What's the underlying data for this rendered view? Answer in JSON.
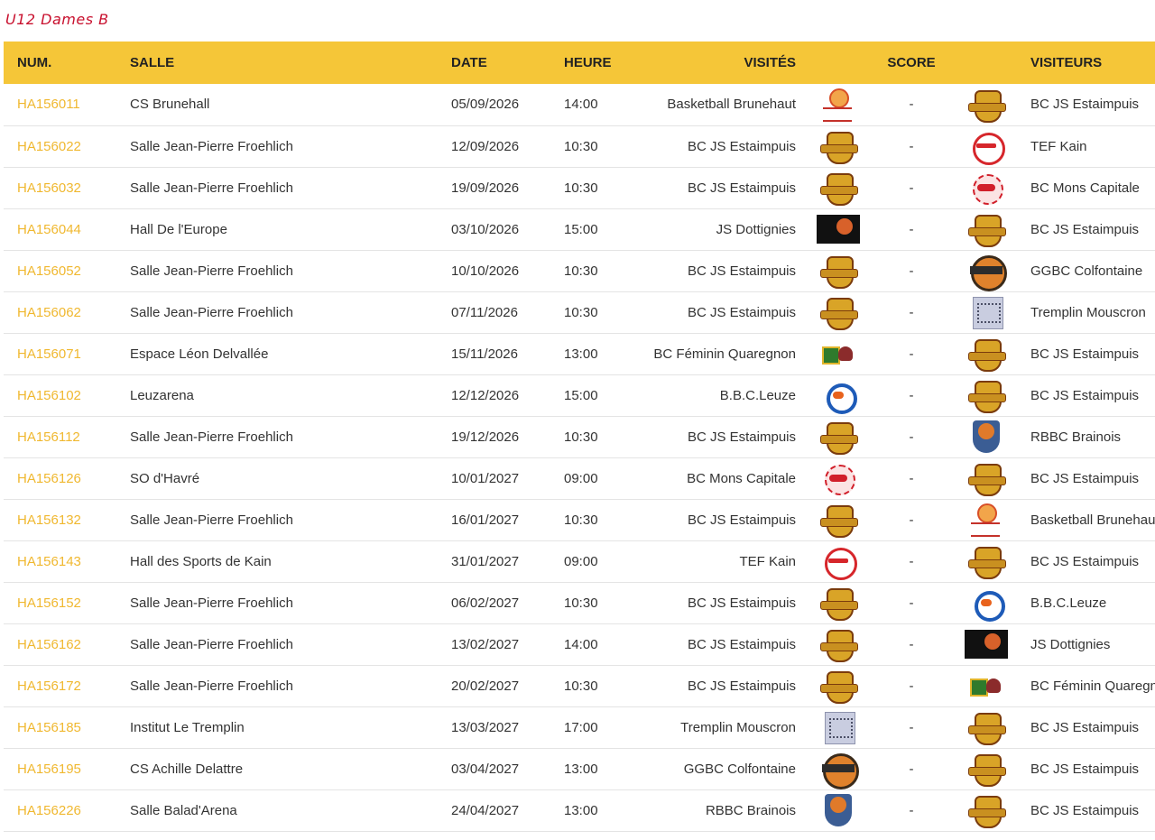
{
  "title": "U12 Dames B",
  "columns": {
    "num": "NUM.",
    "salle": "SALLE",
    "date": "DATE",
    "heure": "HEURE",
    "visites": "VISITÉS",
    "score": "SCORE",
    "visiteurs": "VISITEURS"
  },
  "colors": {
    "header_bg": "#f5c638",
    "num_link": "#f0b830",
    "title": "#c8102e"
  },
  "matches": [
    {
      "num": "HA156011",
      "salle": "CS Brunehall",
      "date": "05/09/2026",
      "heure": "14:00",
      "home": "Basketball Brunehaut",
      "home_logo": "brunehaut",
      "score": "-",
      "away": "BC JS Estaimpuis",
      "away_logo": "estaimpuis"
    },
    {
      "num": "HA156022",
      "salle": "Salle Jean-Pierre Froehlich",
      "date": "12/09/2026",
      "heure": "10:30",
      "home": "BC JS Estaimpuis",
      "home_logo": "estaimpuis",
      "score": "-",
      "away": "TEF Kain",
      "away_logo": "kain"
    },
    {
      "num": "HA156032",
      "salle": "Salle Jean-Pierre Froehlich",
      "date": "19/09/2026",
      "heure": "10:30",
      "home": "BC JS Estaimpuis",
      "home_logo": "estaimpuis",
      "score": "-",
      "away": "BC Mons Capitale",
      "away_logo": "mons"
    },
    {
      "num": "HA156044",
      "salle": "Hall De l'Europe",
      "date": "03/10/2026",
      "heure": "15:00",
      "home": "JS Dottignies",
      "home_logo": "dottignies",
      "score": "-",
      "away": "BC JS Estaimpuis",
      "away_logo": "estaimpuis"
    },
    {
      "num": "HA156052",
      "salle": "Salle Jean-Pierre Froehlich",
      "date": "10/10/2026",
      "heure": "10:30",
      "home": "BC JS Estaimpuis",
      "home_logo": "estaimpuis",
      "score": "-",
      "away": "GGBC Colfontaine",
      "away_logo": "colfontaine"
    },
    {
      "num": "HA156062",
      "salle": "Salle Jean-Pierre Froehlich",
      "date": "07/11/2026",
      "heure": "10:30",
      "home": "BC JS Estaimpuis",
      "home_logo": "estaimpuis",
      "score": "-",
      "away": "Tremplin Mouscron",
      "away_logo": "tremplin"
    },
    {
      "num": "HA156071",
      "salle": "Espace Léon Delvallée",
      "date": "15/11/2026",
      "heure": "13:00",
      "home": "BC Féminin Quaregnon",
      "home_logo": "quaregnon",
      "score": "-",
      "away": "BC JS Estaimpuis",
      "away_logo": "estaimpuis"
    },
    {
      "num": "HA156102",
      "salle": "Leuzarena",
      "date": "12/12/2026",
      "heure": "15:00",
      "home": "B.B.C.Leuze",
      "home_logo": "leuze",
      "score": "-",
      "away": "BC JS Estaimpuis",
      "away_logo": "estaimpuis"
    },
    {
      "num": "HA156112",
      "salle": "Salle Jean-Pierre Froehlich",
      "date": "19/12/2026",
      "heure": "10:30",
      "home": "BC JS Estaimpuis",
      "home_logo": "estaimpuis",
      "score": "-",
      "away": "RBBC Brainois",
      "away_logo": "brainois"
    },
    {
      "num": "HA156126",
      "salle": "SO d'Havré",
      "date": "10/01/2027",
      "heure": "09:00",
      "home": "BC Mons Capitale",
      "home_logo": "mons",
      "score": "-",
      "away": "BC JS Estaimpuis",
      "away_logo": "estaimpuis"
    },
    {
      "num": "HA156132",
      "salle": "Salle Jean-Pierre Froehlich",
      "date": "16/01/2027",
      "heure": "10:30",
      "home": "BC JS Estaimpuis",
      "home_logo": "estaimpuis",
      "score": "-",
      "away": "Basketball Brunehaut",
      "away_logo": "brunehaut"
    },
    {
      "num": "HA156143",
      "salle": "Hall des Sports de Kain",
      "date": "31/01/2027",
      "heure": "09:00",
      "home": "TEF Kain",
      "home_logo": "kain",
      "score": "-",
      "away": "BC JS Estaimpuis",
      "away_logo": "estaimpuis"
    },
    {
      "num": "HA156152",
      "salle": "Salle Jean-Pierre Froehlich",
      "date": "06/02/2027",
      "heure": "10:30",
      "home": "BC JS Estaimpuis",
      "home_logo": "estaimpuis",
      "score": "-",
      "away": "B.B.C.Leuze",
      "away_logo": "leuze"
    },
    {
      "num": "HA156162",
      "salle": "Salle Jean-Pierre Froehlich",
      "date": "13/02/2027",
      "heure": "14:00",
      "home": "BC JS Estaimpuis",
      "home_logo": "estaimpuis",
      "score": "-",
      "away": "JS Dottignies",
      "away_logo": "dottignies"
    },
    {
      "num": "HA156172",
      "salle": "Salle Jean-Pierre Froehlich",
      "date": "20/02/2027",
      "heure": "10:30",
      "home": "BC JS Estaimpuis",
      "home_logo": "estaimpuis",
      "score": "-",
      "away": "BC Féminin Quaregnon",
      "away_logo": "quaregnon"
    },
    {
      "num": "HA156185",
      "salle": "Institut Le Tremplin",
      "date": "13/03/2027",
      "heure": "17:00",
      "home": "Tremplin Mouscron",
      "home_logo": "tremplin",
      "score": "-",
      "away": "BC JS Estaimpuis",
      "away_logo": "estaimpuis"
    },
    {
      "num": "HA156195",
      "salle": "CS Achille Delattre",
      "date": "03/04/2027",
      "heure": "13:00",
      "home": "GGBC Colfontaine",
      "home_logo": "colfontaine",
      "score": "-",
      "away": "BC JS Estaimpuis",
      "away_logo": "estaimpuis"
    },
    {
      "num": "HA156226",
      "salle": "Salle Balad'Arena",
      "date": "24/04/2027",
      "heure": "13:00",
      "home": "RBBC Brainois",
      "home_logo": "brainois",
      "score": "-",
      "away": "BC JS Estaimpuis",
      "away_logo": "estaimpuis"
    }
  ]
}
